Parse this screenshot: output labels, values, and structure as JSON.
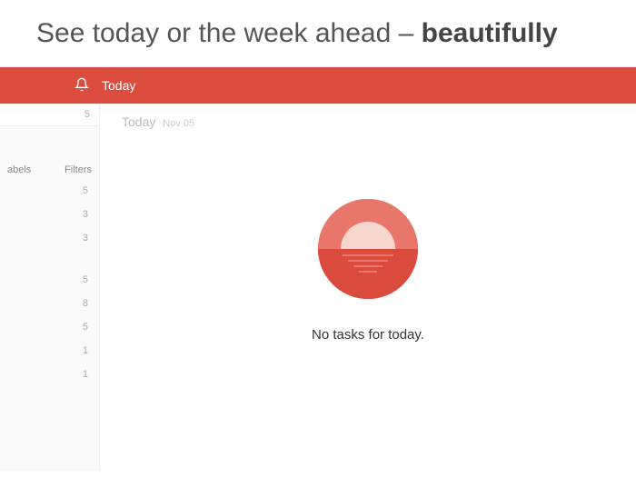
{
  "headline": {
    "prefix": "See today or the week ahead – ",
    "emphasis": "beautifully"
  },
  "topbar": {
    "title": "Today"
  },
  "sidebar": {
    "top_count": "5",
    "tabs": {
      "labels": "abels",
      "filters": "Filters"
    },
    "counts_a": [
      "5",
      "3",
      "3"
    ],
    "counts_b": [
      "5",
      "8",
      "5",
      "1",
      "1"
    ]
  },
  "main": {
    "heading": "Today",
    "heading_sub": "Nov 05",
    "empty_message": "No tasks for today."
  },
  "colors": {
    "brand": "#dc4c3f",
    "sun_outer": "#da4b3e",
    "sun_band": "#e9766a",
    "sun_circle": "#f5c6bd"
  }
}
